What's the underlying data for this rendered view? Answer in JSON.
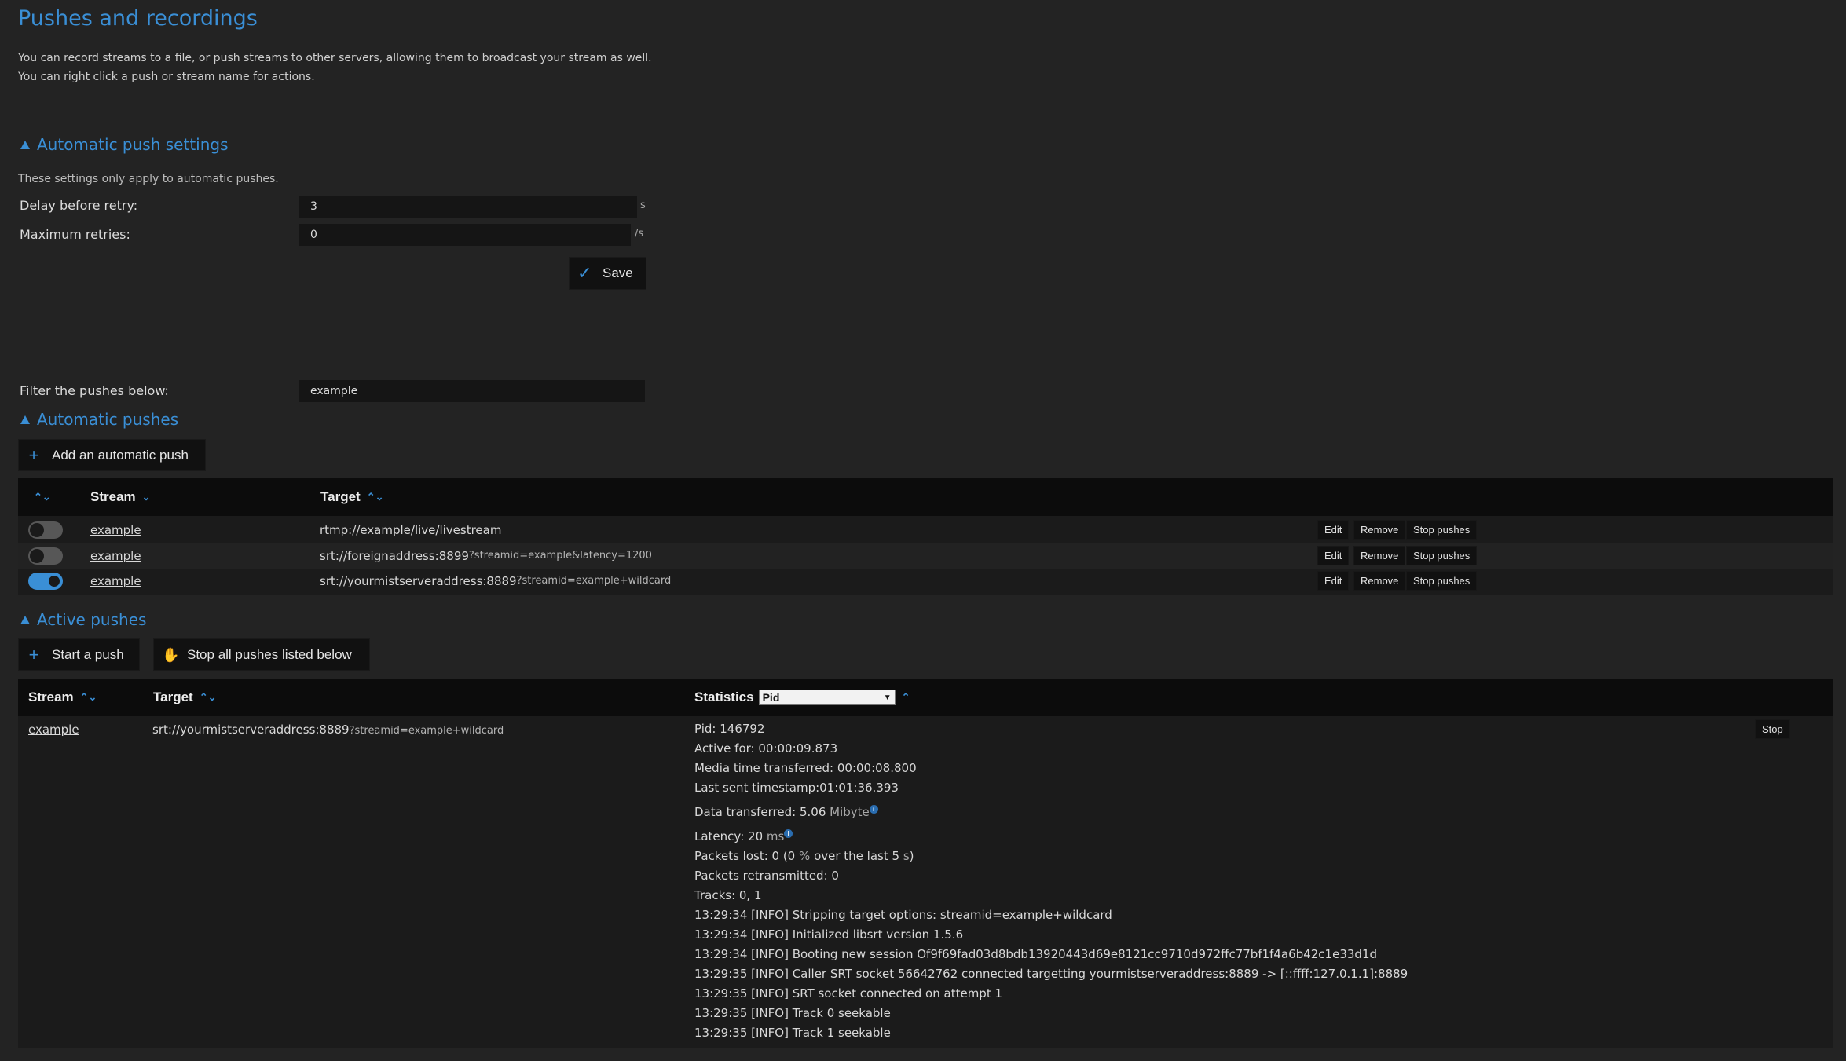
{
  "page": {
    "title": "Pushes and recordings",
    "intro_line1": "You can record streams to a file, or push streams to other servers, allowing them to broadcast your stream as well.",
    "intro_line2": "You can right click a push or stream name for actions."
  },
  "auto_settings": {
    "heading": "Automatic push settings",
    "note": "These settings only apply to automatic pushes.",
    "delay_label": "Delay before retry:",
    "delay_value": "3",
    "delay_unit": "s",
    "retries_label": "Maximum retries:",
    "retries_value": "0",
    "retries_unit": "/s",
    "save_label": "Save"
  },
  "filter": {
    "label": "Filter the pushes below:",
    "value": "example"
  },
  "auto_pushes": {
    "heading": "Automatic pushes",
    "add_label": "Add an automatic push",
    "col_stream": "Stream",
    "col_target": "Target",
    "rows": [
      {
        "stream": "example",
        "target_main": "rtmp://example/live/livestream",
        "target_params": "",
        "enabled": false
      },
      {
        "stream": "example",
        "target_main": "srt://foreignaddress:8899",
        "target_params": "?streamid=example&latency=1200",
        "enabled": false
      },
      {
        "stream": "example",
        "target_main": "srt://yourmistserveraddress:8889",
        "target_params": "?streamid=example+wildcard",
        "enabled": true
      }
    ],
    "edit_label": "Edit",
    "remove_label": "Remove",
    "stop_label": "Stop pushes"
  },
  "active_pushes": {
    "heading": "Active pushes",
    "start_label": "Start a push",
    "stop_all_label": "Stop all pushes listed below",
    "col_stream": "Stream",
    "col_target": "Target",
    "col_stats": "Statistics",
    "stats_select": "Pid",
    "row": {
      "stream": "example",
      "target_main": "srt://yourmistserveraddress:8889",
      "target_params": "?streamid=example+wildcard",
      "stop_label": "Stop",
      "pid": "Pid: 146792",
      "active_for": "Active for: 00:00:09.873",
      "media_time": "Media time transferred: 00:00:08.800",
      "last_ts": "Last sent timestamp:01:01:36.393",
      "data_prefix": "Data transferred: 5.06",
      "data_unit": "Mibyte",
      "latency_prefix": "Latency: 20",
      "latency_unit": "ms",
      "packets_lost_prefix": "Packets lost: 0 (0",
      "packets_lost_mid": "%",
      "packets_lost_suffix": "over the last 5",
      "packets_lost_unit": "s",
      "packets_lost_close": ")",
      "retransmitted": "Packets retransmitted: 0",
      "tracks": "Tracks: 0, 1",
      "log": [
        "13:29:34 [INFO] Stripping target options: streamid=example+wildcard",
        "13:29:34 [INFO] Initialized libsrt version 1.5.6",
        "13:29:34 [INFO] Booting new session Of9f69fad03d8bdb13920443d69e8121cc9710d972ffc77bf1f4a6b42c1e33d1d",
        "13:29:35 [INFO] Caller SRT socket 56642762 connected targetting yourmistserveraddress:8889 -> [::ffff:127.0.1.1]:8889",
        "13:29:35 [INFO] SRT socket connected on attempt 1",
        "13:29:35 [INFO] Track 0 seekable",
        "13:29:35 [INFO] Track 1 seekable"
      ]
    }
  },
  "colors": {
    "accent": "#3a8fd6",
    "background": "#232323",
    "header": "#0c0c0c"
  },
  "icons": {
    "plus": "plus-icon",
    "check": "check-icon",
    "hand": "hand-icon",
    "sort": "sort-icon"
  }
}
